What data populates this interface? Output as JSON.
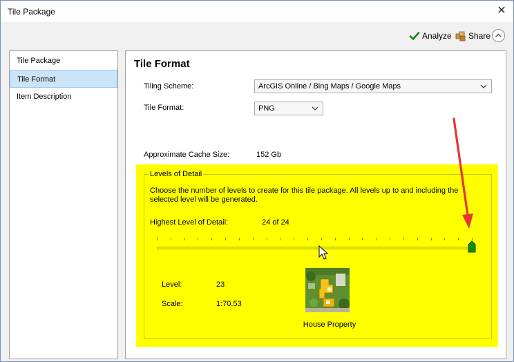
{
  "window": {
    "title": "Tile Package",
    "close_glyph": "✕"
  },
  "toolbar": {
    "analyze_label": "Analyze",
    "share_label": "Share"
  },
  "sidebar": {
    "items": [
      {
        "label": "Tile Package"
      },
      {
        "label": "Tile Format"
      },
      {
        "label": "Item Description"
      }
    ]
  },
  "main": {
    "heading": "Tile Format",
    "tiling_scheme": {
      "label": "Tiling Scheme:",
      "value": "ArcGIS Online / Bing Maps / Google Maps"
    },
    "tile_format": {
      "label": "Tile Format:",
      "value": "PNG"
    },
    "cache_size": {
      "label": "Approximate Cache Size:",
      "value": "152 Gb"
    },
    "levels_of_detail": {
      "legend": "Levels of Detail",
      "description": "Choose the number of levels to create for this tile package.  All levels up to and including the selected level will be generated.",
      "highest_label": "Highest Level of Detail:",
      "highest_value": "24 of 24",
      "slider_level_fraction": 1.0,
      "level_label": "Level:",
      "level_value": "23",
      "scale_label": "Scale:",
      "scale_value": "1:70.53",
      "thumbnail_caption": "House Property"
    }
  },
  "colors": {
    "highlight": "#ffff00",
    "accent_selected": "#cce4f7",
    "slider_thumb": "#118a11",
    "annotation_arrow": "#e53535"
  },
  "icons": {
    "analyze": "checkmark-icon",
    "share": "share-package-icon",
    "collapse": "chevron-up-circle-icon",
    "close": "close-icon"
  }
}
